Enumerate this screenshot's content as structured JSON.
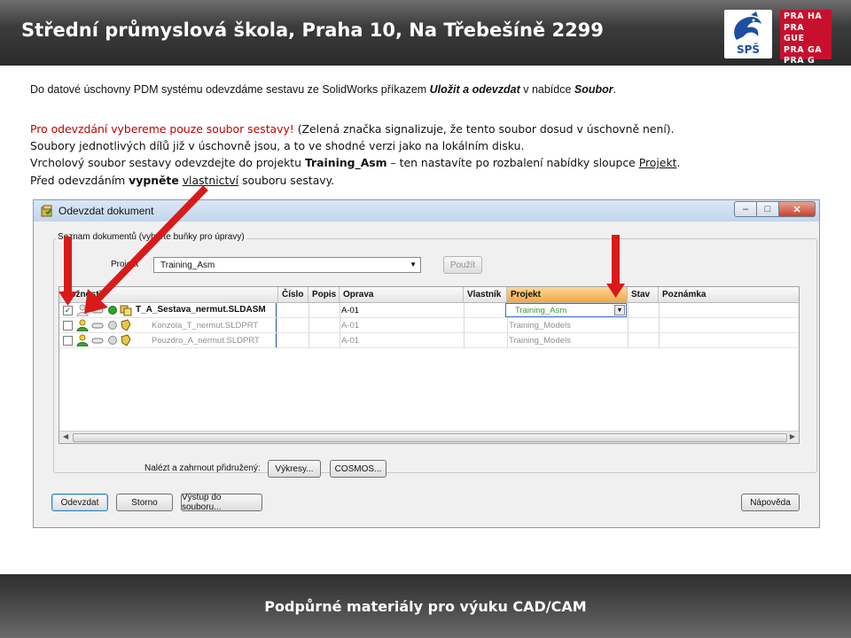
{
  "slide": {
    "title": "Střední průmyslová škola, Praha 10, Na Třebešíně 2299",
    "footer": "Podpůrné materiály pro výuku CAD/CAM"
  },
  "logos": {
    "sps_text": "SPŠ",
    "prague_lines": [
      "PRA HA",
      "PRA GUE",
      "PRA GA",
      "PRA G"
    ]
  },
  "instructions": {
    "intro": {
      "prefix": "Do datové úschovny PDM systému odevzdáme sestavu ze SolidWorks příkazem ",
      "command": "Uložit a odevzdat",
      "middle": " v nabídce ",
      "menu": "Soubor",
      "suffix": "."
    },
    "line1_red": "Pro odevzdání vybereme pouze soubor sestavy!",
    "line1_rest": " (Zelená značka signalizuje, že tento soubor dosud v úschovně není).",
    "line2": "Soubory jednotlivých dílů již v úschovně jsou, a to ve shodné verzi jako na lokálním disku.",
    "line3": {
      "prefix": "Vrcholový soubor sestavy odevzdejte do projektu ",
      "project": "Training_Asm",
      "middle": " – ten nastavíte po rozbalení nabídky sloupce ",
      "column": "Projekt",
      "suffix": "."
    },
    "line4": {
      "prefix": "Před odevzdáním ",
      "bold": "vypněte",
      "space": " ",
      "underlined": "vlastnictví",
      "suffix": " souboru sestavy."
    }
  },
  "dialog": {
    "title": "Odevzdat dokument",
    "window_buttons": [
      "minimize",
      "maximize",
      "close"
    ],
    "group_label": "Seznam dokumentů (vyberte buňky pro úpravy)",
    "project_label": "Projekt",
    "project_value": "Training_Asm",
    "apply_button": "Použít",
    "columns": [
      "Možnosti",
      "Číslo",
      "Popis",
      "Oprava",
      "Vlastník",
      "Projekt",
      "Stav",
      "Poznámka"
    ],
    "rows": [
      {
        "checked": true,
        "name": "T_A_Sestava_nermut.SLDASM",
        "revision": "A-01",
        "project": "Training_Asm",
        "status_icon": "green-dot-icon"
      },
      {
        "checked": false,
        "name": "Konzola_T_nermut.SLDPRT",
        "revision": "A-01",
        "project": "Training_Models",
        "status_icon": "gray-dot-icon"
      },
      {
        "checked": false,
        "name": "Pouzdro_A_nermut.SLDPRT",
        "revision": "A-01",
        "project": "Training_Models",
        "status_icon": "gray-dot-icon"
      }
    ],
    "find_label": "Nalézt a zahrnout přidružený:",
    "drawings_button": "Výkresy...",
    "cosmos_button": "COSMOS...",
    "submit_button": "Odevzdat",
    "cancel_button": "Storno",
    "export_button": "Výstup do souboru...",
    "help_button": "Nápověda"
  },
  "colors": {
    "accent_red": "#c00000",
    "arrow_red": "#d81a1a",
    "sorted_header": "#f1a845",
    "new_file_green": "#2ea62e"
  }
}
